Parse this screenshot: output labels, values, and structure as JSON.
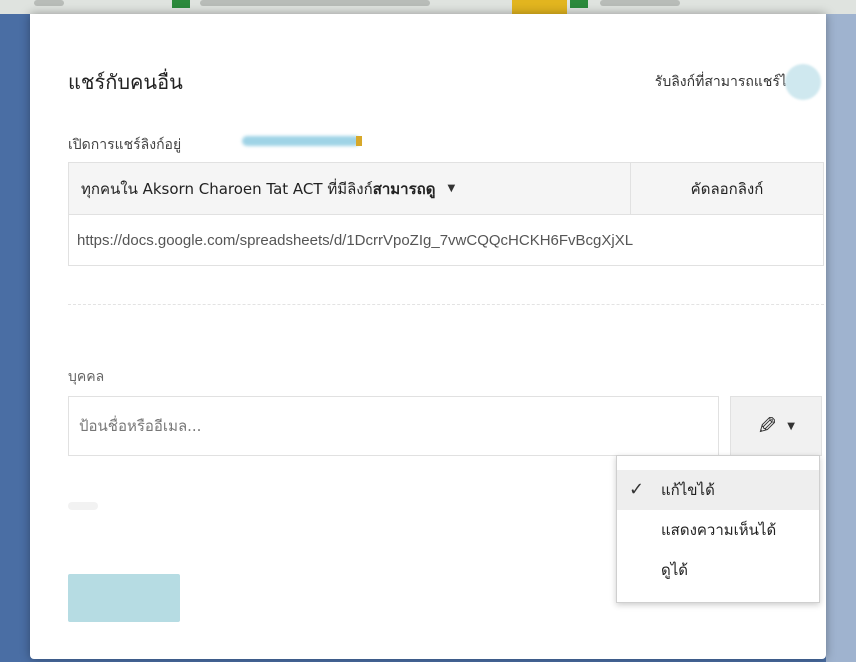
{
  "dialog": {
    "title": "แชร์กับคนอื่น",
    "get_link_label": "รับลิงก์ที่สามารถแชร์ได้"
  },
  "link_sharing": {
    "status_label": "เปิดการแชร์ลิงก์อยู่",
    "access_prefix": "ทุกคนใน Aksorn Charoen Tat ACT ที่มีลิงก์",
    "access_level": "สามารถดู",
    "copy_button_label": "คัดลอกลิงก์",
    "url": "https://docs.google.com/spreadsheets/d/1DcrrVpoZIg_7vwCQQcHCKH6FvBcgXjXL"
  },
  "people": {
    "label": "บุคคล",
    "input_placeholder": "ป้อนชื่อหรืออีเมล..."
  },
  "permission_menu": {
    "items": [
      {
        "label": "แก้ไขได้",
        "selected": true
      },
      {
        "label": "แสดงความเห็นได้",
        "selected": false
      },
      {
        "label": "ดูได้",
        "selected": false
      }
    ]
  },
  "icons": {
    "permission": "pencil-icon",
    "dropdown": "caret-down-icon",
    "selected": "checkmark-icon"
  },
  "colors": {
    "backdrop": "#4a6ea4",
    "send_button": "#b6dce3",
    "menu_selected": "#eeeeee"
  }
}
